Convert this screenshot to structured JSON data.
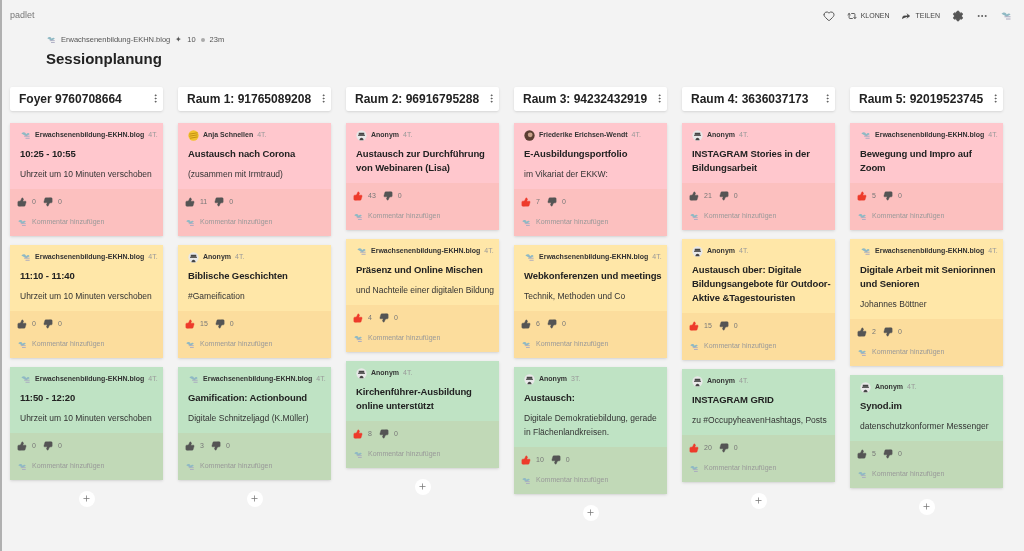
{
  "app": {
    "brand": "padlet",
    "actions": [
      {
        "kind": "like"
      },
      {
        "kind": "clone",
        "label": "KLONEN"
      },
      {
        "kind": "share",
        "label": "TEILEN"
      },
      {
        "kind": "settings"
      },
      {
        "kind": "more"
      },
      {
        "kind": "avatar"
      }
    ]
  },
  "board": {
    "author": "Erwachsenenbildung-EKHN.blog",
    "like_symbol": "✦",
    "likes": "10",
    "age": "23m",
    "title": "Sessionplanung"
  },
  "columns": [
    {
      "title": "Foyer 9760708664",
      "cards": [
        {
          "color": "#ffc7cd",
          "author": "Erwachsenenbildung-EKHN.blog",
          "avatar": {
            "kind": "logo"
          },
          "age": "4T.",
          "title": "10:25 - 10:55",
          "body": "Uhrzeit um 10 Minuten verschoben",
          "up": "0",
          "down": "0",
          "liked": false,
          "comment": "Kommentar hinzufügen"
        },
        {
          "color": "#ffe7a8",
          "author": "Erwachsenenbildung-EKHN.blog",
          "avatar": {
            "kind": "logo"
          },
          "age": "4T.",
          "title": "11:10 - 11:40",
          "body": "Uhrzeit um 10 Minuten verschoben",
          "up": "0",
          "down": "0",
          "liked": false,
          "comment": "Kommentar hinzufügen"
        },
        {
          "color": "#bfe3c4",
          "author": "Erwachsenenbildung-EKHN.blog",
          "avatar": {
            "kind": "logo"
          },
          "age": "4T.",
          "title": "11:50 - 12:20",
          "body": "Uhrzeit um 10 Minuten verschoben",
          "up": "0",
          "down": "0",
          "liked": false,
          "comment": "Kommentar hinzufügen"
        }
      ]
    },
    {
      "title": "Raum 1: 91765089208",
      "cards": [
        {
          "color": "#ffc7cd",
          "author": "Anja Schnellen",
          "avatar": {
            "kind": "sun"
          },
          "age": "4T.",
          "title": "Austausch nach Corona",
          "body": "(zusammen mit Irmtraud)",
          "up": "11",
          "down": "0",
          "liked": false,
          "comment": "Kommentar hinzufügen"
        },
        {
          "color": "#ffe7a8",
          "author": "Anonym",
          "avatar": {
            "kind": "anon"
          },
          "age": "4T.",
          "title": "Biblische Geschichten",
          "body": "#Gameification",
          "up": "15",
          "down": "0",
          "liked": true,
          "comment": "Kommentar hinzufügen"
        },
        {
          "color": "#bfe3c4",
          "author": "Erwachsenenbildung-EKHN.blog",
          "avatar": {
            "kind": "logo"
          },
          "age": "4T.",
          "title": "Gamification: Actionbound",
          "body": "Digitale Schnitzeljagd (K.Müller)",
          "up": "3",
          "down": "0",
          "liked": false,
          "comment": "Kommentar hinzufügen"
        }
      ]
    },
    {
      "title": "Raum 2: 96916795288",
      "cards": [
        {
          "color": "#ffc7cd",
          "author": "Anonym",
          "avatar": {
            "kind": "anon"
          },
          "age": "4T.",
          "title": "Austausch zur Durchführung von Webinaren (Lisa)",
          "up": "43",
          "down": "0",
          "liked": true,
          "comment": "Kommentar hinzufügen"
        },
        {
          "color": "#ffe7a8",
          "author": "Erwachsenenbildung-EKHN.blog",
          "avatar": {
            "kind": "logo"
          },
          "age": "4T.",
          "title": "Präsenz und Online Mischen",
          "body": "und Nachteile einer digitalen Bildung",
          "up": "4",
          "down": "0",
          "liked": true,
          "comment": "Kommentar hinzufügen"
        },
        {
          "color": "#bfe3c4",
          "author": "Anonym",
          "avatar": {
            "kind": "anon"
          },
          "age": "4T.",
          "title": "Kirchenführer-Ausbildung online unterstützt",
          "up": "8",
          "down": "0",
          "liked": true,
          "comment": "Kommentar hinzufügen"
        }
      ]
    },
    {
      "title": "Raum 3: 94232432919",
      "cards": [
        {
          "color": "#ffc7cd",
          "author": "Friederike Erichsen-Wendt",
          "avatar": {
            "kind": "photo"
          },
          "age": "4T.",
          "title": "E-Ausbildungsportfolio",
          "body": "im Vikariat der EKKW:",
          "up": "7",
          "down": "0",
          "liked": true,
          "comment": "Kommentar hinzufügen"
        },
        {
          "color": "#ffe7a8",
          "author": "Erwachsenenbildung-EKHN.blog",
          "avatar": {
            "kind": "logo"
          },
          "age": "4T.",
          "title": "Webkonferenzen und meetings",
          "body": "Technik, Methoden und Co",
          "up": "6",
          "down": "0",
          "liked": false,
          "comment": "Kommentar hinzufügen"
        },
        {
          "color": "#bfe3c4",
          "author": "Anonym",
          "avatar": {
            "kind": "anon"
          },
          "age": "3T.",
          "title": "Austausch:",
          "body": "Digitale Demokratiebildung, gerade in Flächenlandkreisen.",
          "up": "10",
          "down": "0",
          "liked": true,
          "comment": "Kommentar hinzufügen"
        }
      ]
    },
    {
      "title": "Raum 4: 3636037173",
      "cards": [
        {
          "color": "#ffc7cd",
          "author": "Anonym",
          "avatar": {
            "kind": "anon"
          },
          "age": "4T.",
          "title": "INSTAGRAM Stories in der Bildungsarbeit",
          "up": "21",
          "down": "0",
          "liked": false,
          "comment": "Kommentar hinzufügen"
        },
        {
          "color": "#ffe7a8",
          "author": "Anonym",
          "avatar": {
            "kind": "anon"
          },
          "age": "4T.",
          "title": "Austausch über: Digitale Bildungsangebote für Outdoor-Aktive &Tagestouristen",
          "up": "15",
          "down": "0",
          "liked": true,
          "comment": "Kommentar hinzufügen"
        },
        {
          "color": "#bfe3c4",
          "author": "Anonym",
          "avatar": {
            "kind": "anon"
          },
          "age": "4T.",
          "title": "INSTAGRAM GRID",
          "body": "zu #OccupyheavenHashtags, Posts",
          "up": "20",
          "down": "0",
          "liked": true,
          "comment": "Kommentar hinzufügen"
        }
      ]
    },
    {
      "title": "Raum 5: 92019523745",
      "cards": [
        {
          "color": "#ffc7cd",
          "author": "Erwachsenenbildung-EKHN.blog",
          "avatar": {
            "kind": "logo"
          },
          "age": "4T.",
          "title": "Bewegung und Impro auf Zoom",
          "up": "5",
          "down": "0",
          "liked": true,
          "comment": "Kommentar hinzufügen"
        },
        {
          "color": "#ffe7a8",
          "author": "Erwachsenenbildung-EKHN.blog",
          "avatar": {
            "kind": "logo"
          },
          "age": "4T.",
          "title": "Digitale Arbeit mit Seniorinnen und Senioren",
          "body": "Johannes Böttner",
          "up": "2",
          "down": "0",
          "liked": false,
          "comment": "Kommentar hinzufügen"
        },
        {
          "color": "#bfe3c4",
          "author": "Anonym",
          "avatar": {
            "kind": "anon"
          },
          "age": "4T.",
          "title": "Synod.im",
          "body": "datenschutzkonformer Messenger",
          "up": "5",
          "down": "0",
          "liked": false,
          "comment": "Kommentar hinzufügen"
        }
      ]
    }
  ]
}
